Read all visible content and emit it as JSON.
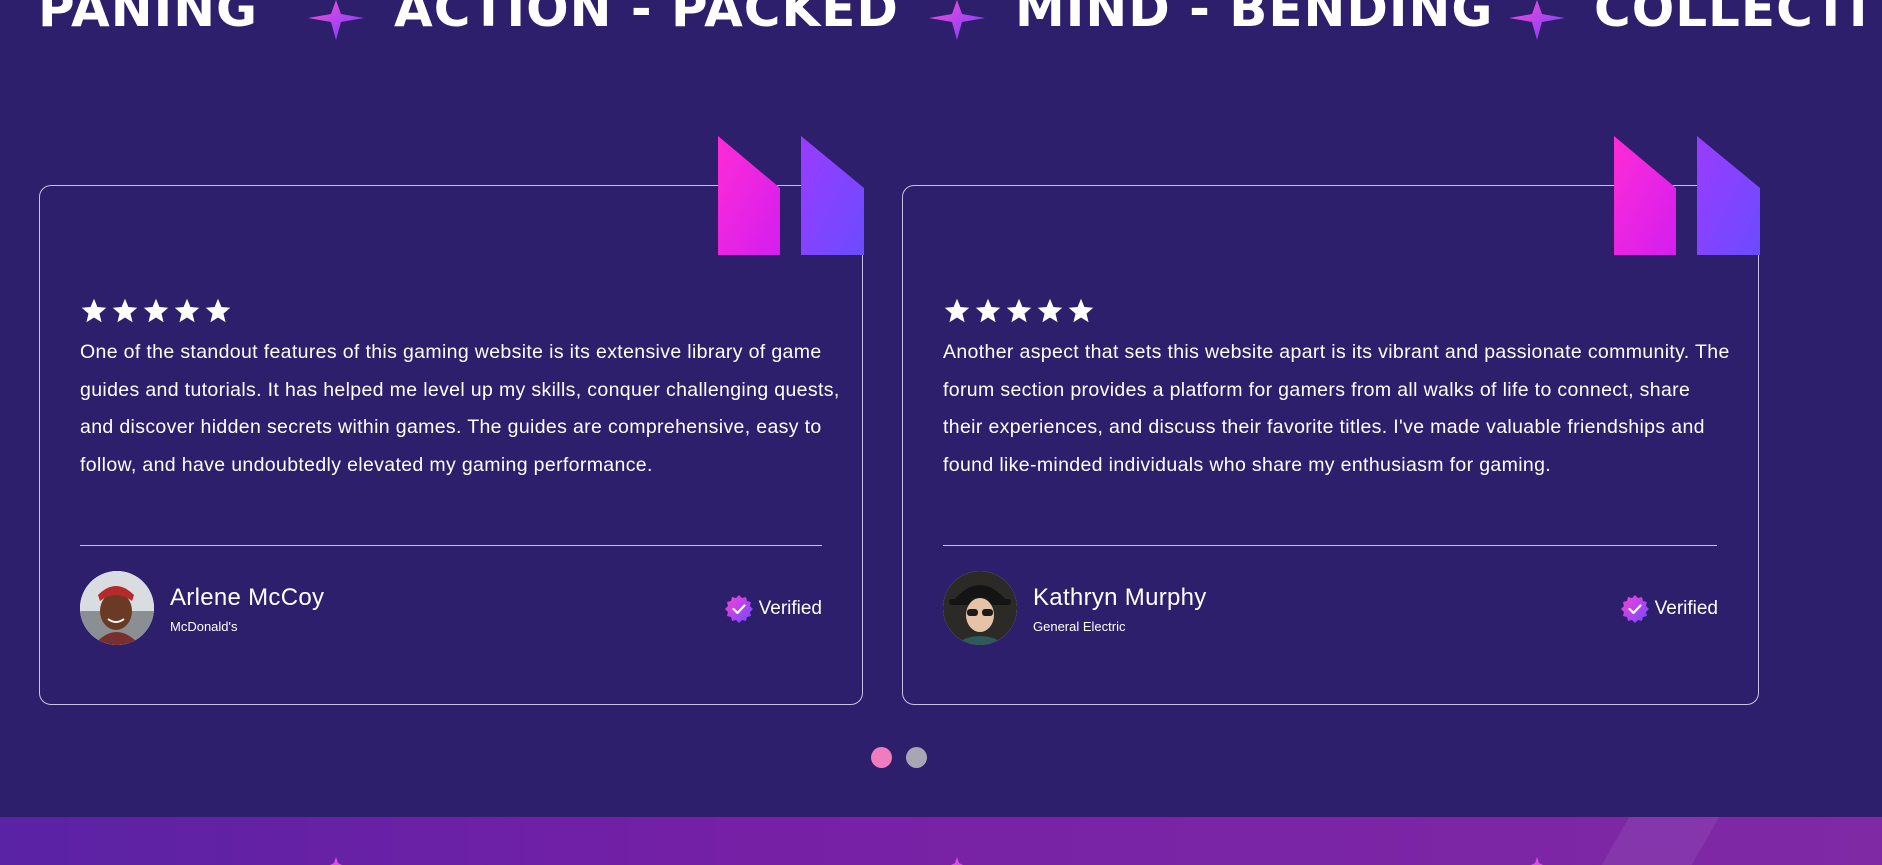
{
  "marquee": {
    "items": [
      "PANING",
      "ACTION - PACKED",
      "MIND - BENDING",
      "COLLECTI"
    ],
    "separator_icon": "sparkle-star-icon"
  },
  "testimonials": [
    {
      "rating": 5,
      "text": "One of the standout features of this gaming website is its extensive library of game guides and tutorials. It has helped me level up my skills, conquer challenging quests, and discover hidden secrets within games. The guides are comprehensive, easy to follow, and have undoubtedly elevated my gaming performance.",
      "author_name": "Arlene McCoy",
      "author_company": "McDonald's",
      "verified_label": "Verified"
    },
    {
      "rating": 5,
      "text": "Another aspect that sets this website apart is its vibrant and passionate community. The forum section provides a platform for gamers from all walks of life to connect, share their experiences, and discuss their favorite titles. I've made valuable friendships and found like-minded individuals who share my enthusiasm for gaming.",
      "author_name": "Kathryn Murphy",
      "author_company": "General Electric",
      "verified_label": "Verified"
    }
  ],
  "pagination": {
    "total": 2,
    "active_index": 0
  },
  "colors": {
    "background": "#2d1f6b",
    "accent_pink": "#ff1fd0",
    "accent_purple": "#7a4dff",
    "active_dot": "#ee7cbf",
    "inactive_dot": "#a8a6b5"
  }
}
